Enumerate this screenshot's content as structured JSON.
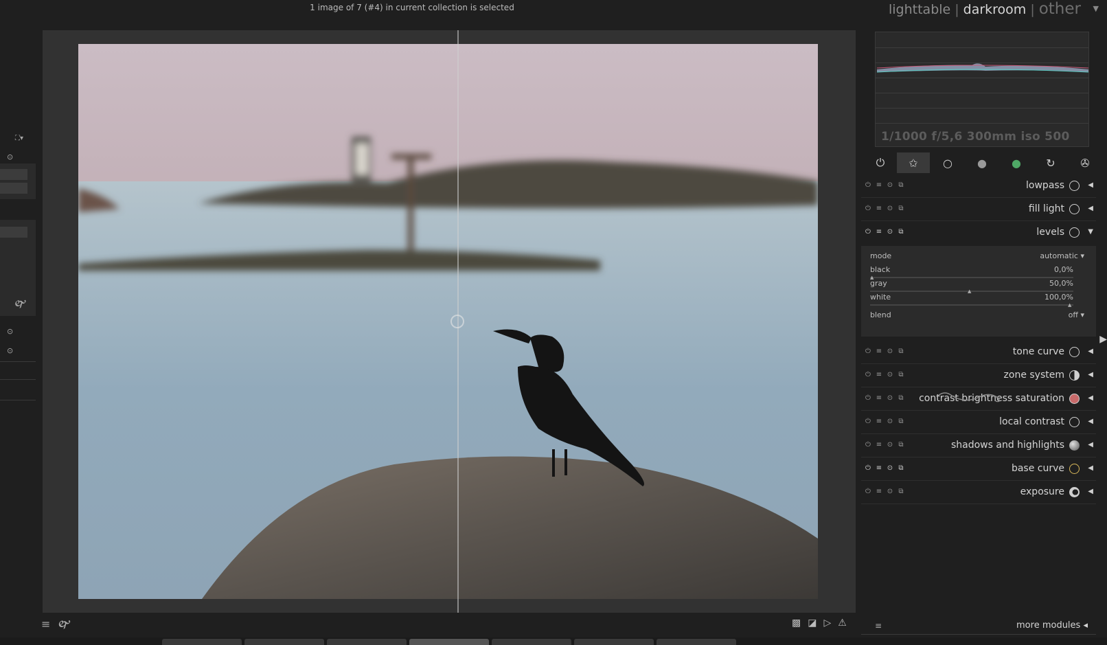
{
  "header": {
    "status": "1 image of 7 (#4) in current collection is selected",
    "views": [
      "lighttable",
      "darkroom",
      "other"
    ],
    "separator": "|",
    "active_view": "darkroom"
  },
  "histogram": {
    "exif": "1/1000 f/5,6 300mm iso 500"
  },
  "module_groups": [
    {
      "icon": "power-icon",
      "glyph": "⏻"
    },
    {
      "icon": "star-icon",
      "glyph": "✩"
    },
    {
      "icon": "circle-outline-icon",
      "glyph": "○"
    },
    {
      "icon": "tone-circle-icon",
      "glyph": "●"
    },
    {
      "icon": "color-circle-icon",
      "glyph": "●"
    },
    {
      "icon": "correct-icon",
      "glyph": "↻"
    },
    {
      "icon": "effect-icon",
      "glyph": "✇"
    }
  ],
  "modules": {
    "lowpass": "lowpass",
    "fill_light": "fill light",
    "levels": "levels",
    "tone_curve": "tone curve",
    "zone_system": "zone system",
    "contrast": "contrast brightness saturation",
    "local_contrast": "local contrast",
    "shadows": "shadows and highlights",
    "base_curve": "base curve",
    "exposure": "exposure"
  },
  "levels": {
    "mode_label": "mode",
    "mode_value": "automatic",
    "black_label": "black",
    "black_value": "0,0%",
    "gray_label": "gray",
    "gray_value": "50,0%",
    "white_label": "white",
    "white_value": "100,0%",
    "blend_label": "blend",
    "blend_value": "off"
  },
  "more_modules": "more modules",
  "colors": {
    "background": "#1f1f1f",
    "panel": "#2b2b2b",
    "text": "#d4d4d4"
  }
}
